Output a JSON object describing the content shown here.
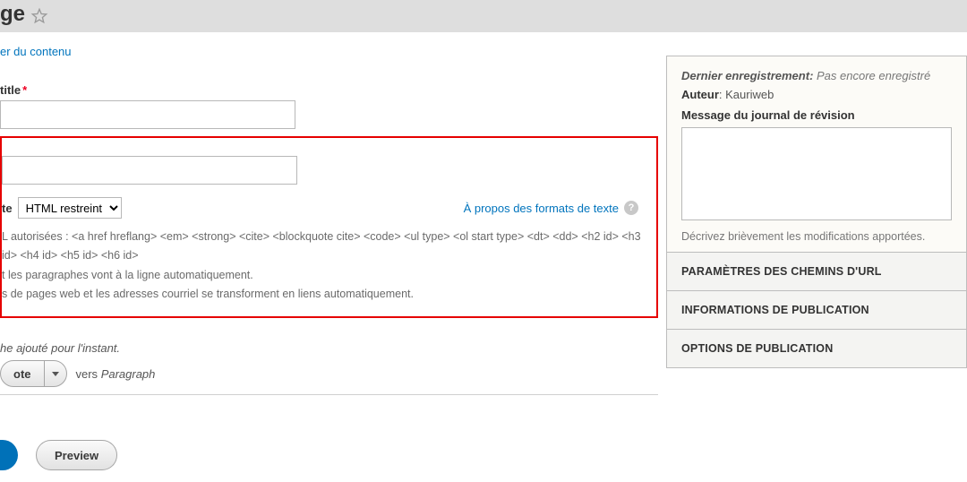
{
  "header": {
    "title_fragment": "ge"
  },
  "breadcrumb": {
    "link_fragment": "er du contenu"
  },
  "fields": {
    "title_label_fragment": "title",
    "title_value": ""
  },
  "format_section": {
    "input_value": "",
    "format_label_fragment": "te",
    "selected_format": "HTML restreint",
    "format_options": [
      "HTML restreint"
    ],
    "help_link": "À propos des formats de texte",
    "hints": [
      "L autorisées : <a href hreflang> <em> <strong> <cite> <blockquote cite> <code> <ul type> <ol start type> <dt> <dd> <h2 id> <h3 id> <h4 id> <h5 id> <h6 id>",
      "t les paragraphes vont à la ligne automatiquement.",
      "s de pages web et les adresses courriel se transforment en liens automatiquement."
    ]
  },
  "paragraphs": {
    "empty_note": "he ajouté pour l'instant.",
    "add_button_fragment": "ote",
    "to_label": "vers",
    "to_target": "Paragraph"
  },
  "actions": {
    "preview": "Preview"
  },
  "sidebar": {
    "last_saved_label": "Dernier enregistrement",
    "last_saved_value": "Pas encore enregistré",
    "author_label": "Auteur",
    "author_value": "Kauriweb",
    "revision_label": "Message du journal de révision",
    "revision_value": "",
    "revision_desc": "Décrivez brièvement les modifications apportées.",
    "accordion": [
      "PARAMÈTRES DES CHEMINS D'URL",
      "INFORMATIONS DE PUBLICATION",
      "OPTIONS DE PUBLICATION"
    ]
  }
}
